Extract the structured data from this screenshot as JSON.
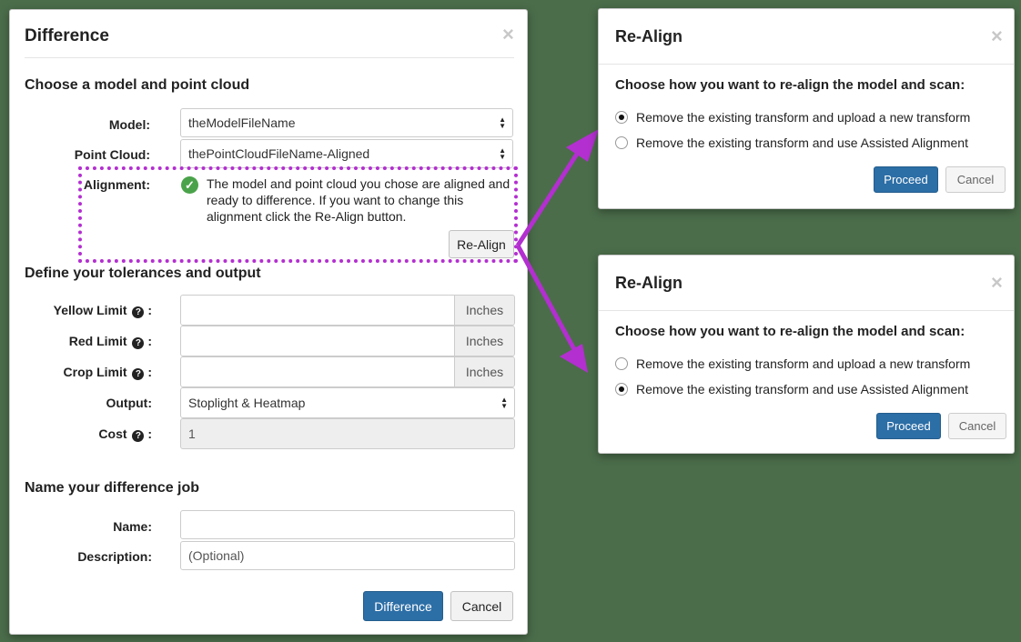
{
  "difference_modal": {
    "title": "Difference",
    "close_glyph": "×",
    "section_model": "Choose a model and point cloud",
    "model_label": "Model:",
    "model_value": "theModelFileName",
    "point_cloud_label": "Point Cloud:",
    "point_cloud_value": "thePointCloudFileName-Aligned",
    "alignment_label": "Alignment:",
    "alignment_icon": "check-circle-icon",
    "alignment_text": "The model and point cloud you chose are aligned and ready to difference. If you want to change this alignment click the Re-Align button.",
    "realign_button": "Re-Align",
    "section_tolerances": "Define your tolerances and output",
    "yellow_limit_label": "Yellow Limit",
    "red_limit_label": "Red Limit",
    "crop_limit_label": "Crop Limit",
    "help_glyph": "?",
    "label_colon": ":",
    "unit_addon": "Inches",
    "yellow_limit_value": "",
    "red_limit_value": "",
    "crop_limit_value": "",
    "output_label": "Output:",
    "output_value": "Stoplight & Heatmap",
    "cost_label": "Cost",
    "cost_value": "1",
    "section_name": "Name your difference job",
    "name_label": "Name:",
    "name_value": "",
    "description_label": "Description:",
    "description_value": "(Optional)",
    "difference_button": "Difference",
    "cancel_button": "Cancel"
  },
  "realign_modals": [
    {
      "title": "Re-Align",
      "close_glyph": "×",
      "prompt": "Choose how you want to re-align the model and scan:",
      "options": [
        {
          "label": "Remove the existing transform and upload a new transform",
          "selected": true
        },
        {
          "label": "Remove the existing transform and use Assisted Alignment",
          "selected": false
        }
      ],
      "proceed_button": "Proceed",
      "cancel_button": "Cancel"
    },
    {
      "title": "Re-Align",
      "close_glyph": "×",
      "prompt": "Choose how you want to re-align the model and scan:",
      "options": [
        {
          "label": "Remove the existing transform and upload a new transform",
          "selected": false
        },
        {
          "label": "Remove the existing transform and use Assisted Alignment",
          "selected": true
        }
      ],
      "proceed_button": "Proceed",
      "cancel_button": "Cancel"
    }
  ],
  "colors": {
    "background": "#4b6d4a",
    "highlight": "#b32fd0",
    "primary_button": "#2c6ea6",
    "success_icon": "#4aa34a"
  }
}
